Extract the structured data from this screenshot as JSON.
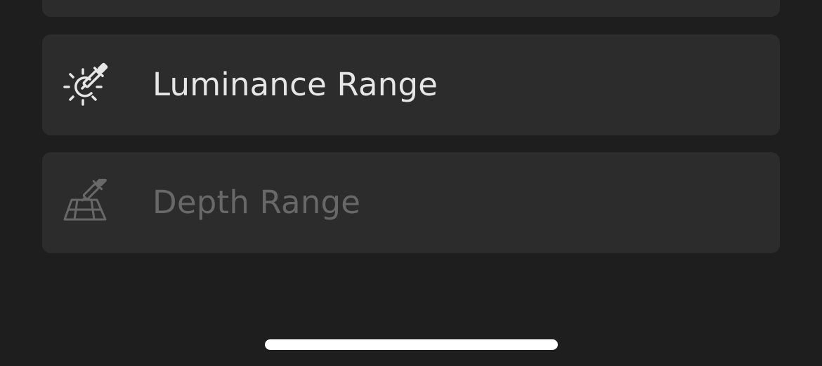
{
  "menu": {
    "items": [
      {
        "label": "Luminance Range",
        "icon": "luminance-eyedropper-icon",
        "enabled": true
      },
      {
        "label": "Depth Range",
        "icon": "depth-eyedropper-icon",
        "enabled": false
      }
    ]
  },
  "colors": {
    "background": "#1e1e1e",
    "card": "#2c2c2c",
    "text_enabled": "#e6e6e6",
    "text_disabled": "#686868"
  }
}
